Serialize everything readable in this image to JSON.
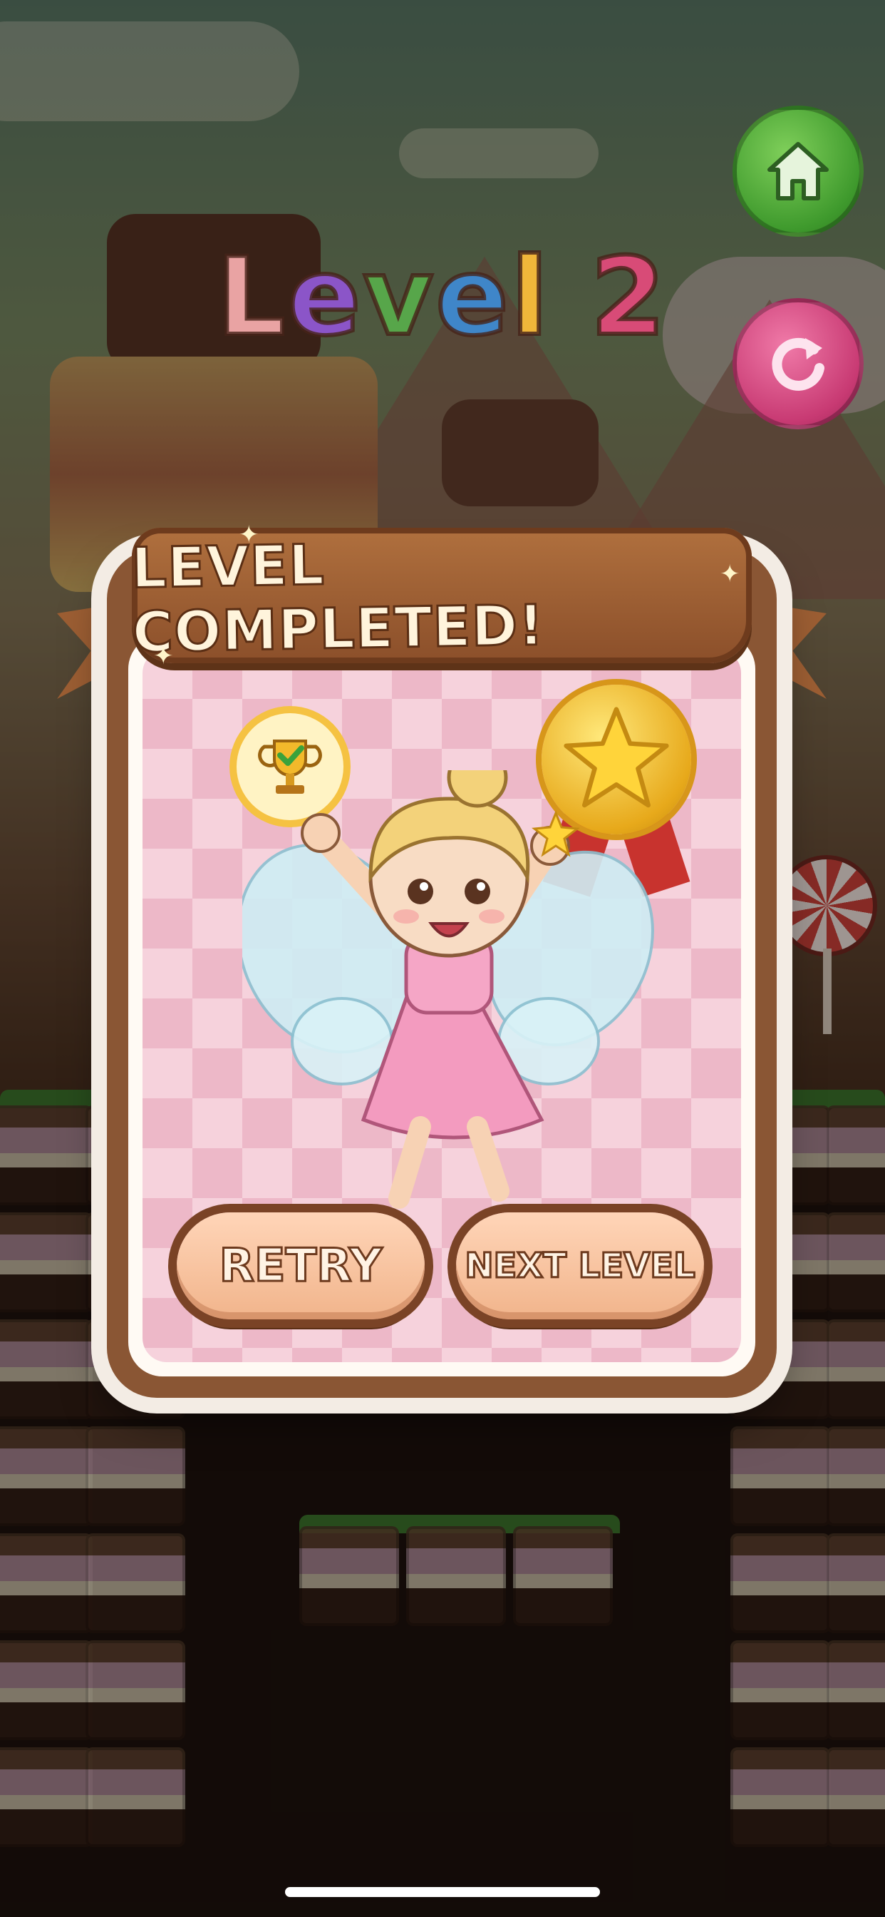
{
  "hud": {
    "level_title": "Level 2",
    "home_icon": "house-icon",
    "restart_icon": "restart-icon"
  },
  "modal": {
    "title": "LEVEL COMPLETED!",
    "retry_label": "RETRY",
    "next_label": "NEXT LEVEL",
    "trophy_icon": "trophy-check-icon",
    "medal_icon": "star-medal-icon"
  },
  "colors": {
    "title_letters": [
      "#e9a3a3",
      "#8b55c8",
      "#57a64a",
      "#3f86c9",
      "#f0b63a",
      "#d84b77"
    ]
  }
}
